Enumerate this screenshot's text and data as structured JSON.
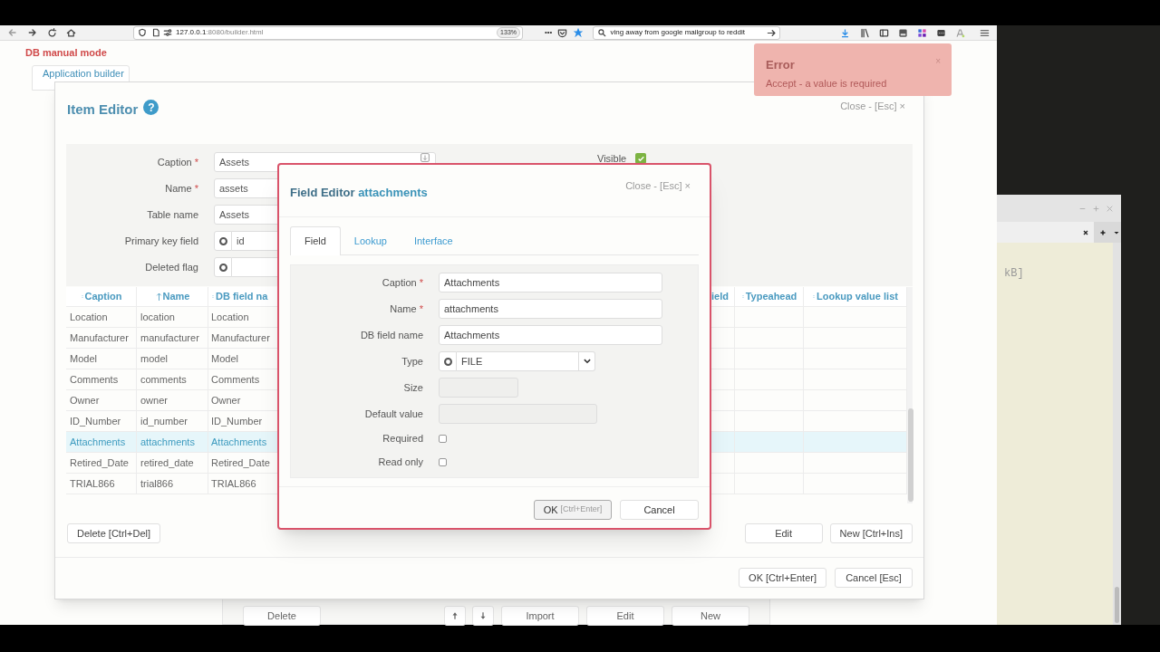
{
  "browser": {
    "url_host": "127.0.0.1",
    "url_path": ":8080/builder.html",
    "zoom": "133%",
    "more": "•••",
    "search_text": "ving away from google mailgroup to reddit"
  },
  "page": {
    "mode_label": "DB manual mode",
    "tab": "Application builder",
    "bottom_buttons": [
      {
        "kind": "text",
        "label": "Delete"
      },
      {
        "kind": "up"
      },
      {
        "kind": "down"
      },
      {
        "kind": "text",
        "label": "Import"
      },
      {
        "kind": "text",
        "label": "Edit"
      },
      {
        "kind": "text",
        "label": "New"
      }
    ]
  },
  "item_editor": {
    "title": "Item Editor",
    "help": "?",
    "close": "Close - [Esc] ×",
    "form": [
      {
        "label": "Caption",
        "mark": "*",
        "kind": "text",
        "value": "Assets"
      },
      {
        "label": "Name",
        "mark": "*",
        "kind": "text",
        "value": "assets"
      },
      {
        "label": "Table name",
        "kind": "text",
        "value": "Assets"
      },
      {
        "label": "Primary key field",
        "kind": "lookup",
        "value": "id"
      },
      {
        "label": "Deleted flag",
        "kind": "lookup"
      }
    ],
    "visible": {
      "label": "Visible",
      "checked": true
    },
    "table": {
      "columns": [
        {
          "label": "Caption",
          "sorted": false
        },
        {
          "label": "Name",
          "sorted": true
        },
        {
          "label": "DB field na",
          "sorted": false
        },
        {
          "label": "ield"
        },
        {
          "label": "Typeahead",
          "sorted": false
        },
        {
          "label": "Lookup value list",
          "sorted": false
        }
      ],
      "rows": [
        {
          "cells": [
            "Location",
            "location",
            "Location"
          ],
          "selected": false
        },
        {
          "cells": [
            "Manufacturer",
            "manufacturer",
            "Manufacturer"
          ],
          "selected": false
        },
        {
          "cells": [
            "Model",
            "model",
            "Model"
          ],
          "selected": false
        },
        {
          "cells": [
            "Comments",
            "comments",
            "Comments"
          ],
          "selected": false
        },
        {
          "cells": [
            "Owner",
            "owner",
            "Owner"
          ],
          "selected": false
        },
        {
          "cells": [
            "ID_Number",
            "id_number",
            "ID_Number"
          ],
          "selected": false
        },
        {
          "cells": [
            "Attachments",
            "attachments",
            "Attachments"
          ],
          "selected": true
        },
        {
          "cells": [
            "Retired_Date",
            "retired_date",
            "Retired_Date"
          ],
          "selected": false
        },
        {
          "cells": [
            "TRIAL866",
            "trial866",
            "TRIAL866"
          ],
          "selected": false
        }
      ]
    },
    "left_buttons": [
      "Delete [Ctrl+Del]"
    ],
    "right_buttons": [
      "Edit",
      "New [Ctrl+Ins]"
    ],
    "footer_buttons": [
      "OK [Ctrl+Enter]",
      "Cancel [Esc]"
    ]
  },
  "field_editor": {
    "title": "Field Editor",
    "title_name": "attachments",
    "close": "Close - [Esc] ×",
    "tabs": [
      {
        "label": "Field",
        "selected": true
      },
      {
        "label": "Lookup",
        "selected": false
      },
      {
        "label": "Interface",
        "selected": false
      }
    ],
    "form": [
      {
        "label": "Caption",
        "mark": "*",
        "kind": "text",
        "value": "Attachments",
        "disabled": false
      },
      {
        "label": "Name",
        "mark": "*",
        "kind": "text",
        "value": "attachments",
        "disabled": false
      },
      {
        "label": "DB field name",
        "kind": "text",
        "value": "Attachments",
        "disabled": false
      },
      {
        "label": "Type",
        "kind": "select",
        "value": "FILE"
      },
      {
        "label": "Size",
        "kind": "number",
        "disabled": true
      },
      {
        "label": "Default value",
        "kind": "text",
        "disabled": true
      },
      {
        "label": "Required",
        "kind": "checkbox",
        "checked": false
      },
      {
        "label": "Read only",
        "kind": "checkbox",
        "checked": false
      }
    ],
    "ok": {
      "label": "OK",
      "hint": "[Ctrl+Enter]"
    },
    "cancel": "Cancel"
  },
  "toast": {
    "title": "Error",
    "message": "Accept - a value is required",
    "close": "×"
  },
  "side_window": {
    "text": "kB]"
  }
}
